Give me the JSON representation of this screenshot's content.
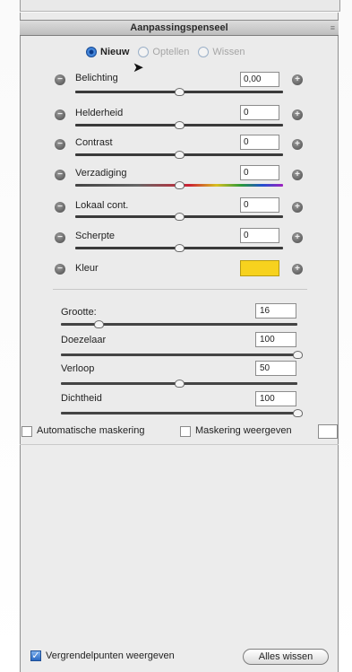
{
  "panel": {
    "title": "Aanpassingspenseel"
  },
  "mode": {
    "options": [
      {
        "label": "Nieuw",
        "selected": true
      },
      {
        "label": "Optellen",
        "selected": false
      },
      {
        "label": "Wissen",
        "selected": false
      }
    ]
  },
  "adjustments": [
    {
      "label": "Belichting",
      "value": "0,00",
      "level": 0.5
    },
    {
      "label": "Helderheid",
      "value": "0",
      "level": 0.5
    },
    {
      "label": "Contrast",
      "value": "0",
      "level": 0.5
    },
    {
      "label": "Verzadiging",
      "value": "0",
      "level": 0.5
    },
    {
      "label": "Lokaal cont.",
      "value": "0",
      "level": 0.5
    },
    {
      "label": "Scherpte",
      "value": "0",
      "level": 0.5
    }
  ],
  "color": {
    "label": "Kleur",
    "swatch": "#f7d21e"
  },
  "brush": [
    {
      "label": "Grootte:",
      "value": "16",
      "level": 0.16
    },
    {
      "label": "Doezelaar",
      "value": "100",
      "level": 1.0
    },
    {
      "label": "Verloop",
      "value": "50",
      "level": 0.5
    },
    {
      "label": "Dichtheid",
      "value": "100",
      "level": 1.0
    }
  ],
  "options": {
    "auto_mask": "Automatische maskering",
    "show_mask": "Maskering weergeven",
    "show_pins": "Vergrendelpunten weergeven",
    "show_pins_checked": true
  },
  "clear_button": "Alles wissen"
}
